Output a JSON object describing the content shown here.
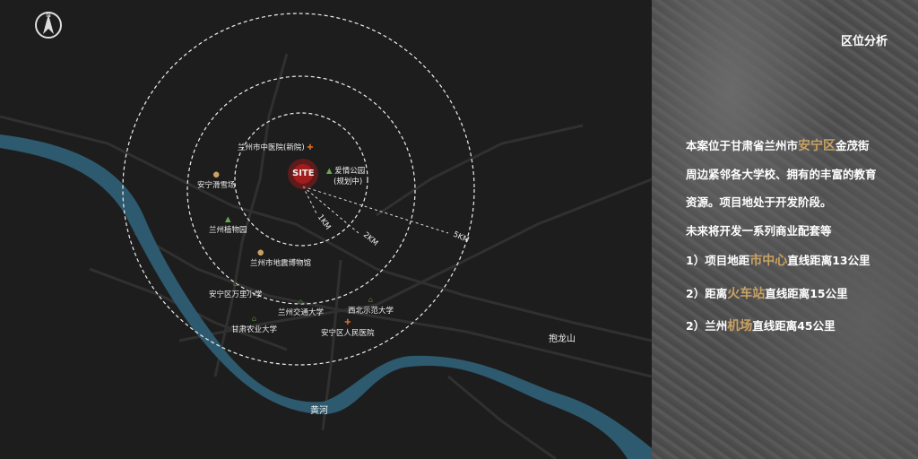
{
  "map": {
    "north_label": "N",
    "site_label": "SITE",
    "rings": [
      "1KM",
      "2KM",
      "5KM"
    ],
    "pois": [
      {
        "name": "兰州市中医院(新院)",
        "icon": "hospital-icon"
      },
      {
        "name": "爱情公园",
        "sub": "(规划中)",
        "icon": "park-icon"
      },
      {
        "name": "安宁滑雪场",
        "icon": "pin-icon"
      },
      {
        "name": "兰州植物园",
        "icon": "park-icon"
      },
      {
        "name": "兰州市地震博物馆",
        "icon": "pin-icon"
      },
      {
        "name": "安宁区万里小学",
        "icon": "school-icon"
      },
      {
        "name": "兰州交通大学",
        "icon": "school-icon"
      },
      {
        "name": "西北示范大学",
        "icon": "school-icon"
      },
      {
        "name": "甘肃农业大学",
        "icon": "school-icon"
      },
      {
        "name": "安宁区人民医院",
        "icon": "hospital-icon"
      }
    ],
    "river_label": "黄河",
    "mountain_label": "抱龙山",
    "colors": {
      "river": "#2d5a6e",
      "hospital": "#d8691f",
      "park": "#6aa84f",
      "pin": "#c9a163",
      "school": "#4f7a3a",
      "site": "#8b1a1a"
    }
  },
  "panel": {
    "title": "区位分析",
    "p1": {
      "a": "本案位于甘肃省兰州市",
      "h": "安宁区",
      "b": "金茂街"
    },
    "p2": "周边紧邻各大学校、拥有的丰富的教育",
    "p3": "资源。项目地处于开发阶段。",
    "p4": "未来将开发一系列商业配套等",
    "l1": {
      "a": "1）项目地距",
      "h": "市中心",
      "b": "直线距离13公里"
    },
    "l2": {
      "a": "2）距离",
      "h": "火车站",
      "b": "直线距离15公里"
    },
    "l3": {
      "a": "2）兰州",
      "h": "机场",
      "b": "直线距离45公里"
    },
    "accent": "#c9a163"
  }
}
